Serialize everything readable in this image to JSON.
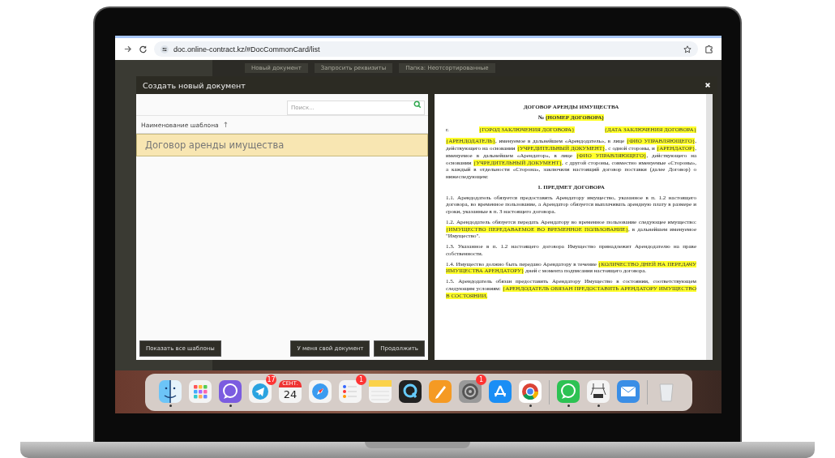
{
  "browser": {
    "url": "doc.online-contract.kz/#DocCommonCard/list"
  },
  "background_toolbar": [
    "Новый документ",
    "Запросить реквизиты",
    "Папка: Неотсортированные"
  ],
  "dialog": {
    "title": "Создать новый документ",
    "search": {
      "placeholder": "Поиск..."
    },
    "column_header": {
      "label": "Наименование шаблона",
      "sort_icon": "↑"
    },
    "templates": [
      {
        "name": "Договор аренды имущества",
        "selected": true
      }
    ],
    "buttons_left": [
      "Показать все шаблоны"
    ],
    "buttons_right": [
      "У меня свой документ",
      "Продолжить"
    ],
    "document": [
      {
        "kind": "title",
        "segments": [
          {
            "text": "ДОГОВОР АРЕНДЫ ИМУЩЕСТВА"
          }
        ]
      },
      {
        "kind": "title",
        "segments": [
          {
            "text": "№ "
          },
          {
            "field": "{НОМЕР ДОГОВОРА}"
          }
        ]
      },
      {
        "kind": "place",
        "segments": [
          {
            "text": "г."
          },
          {
            "field": "{ГОРОД ЗАКЛЮЧЕНИЯ ДОГОВОРА}"
          },
          {
            "field": "{ДАТА ЗАКЛЮЧЕНИЯ ДОГОВОРА}"
          }
        ]
      },
      {
        "kind": "paragraph",
        "segments": [
          {
            "field": "{АРЕНДОДАТЕЛЬ}"
          },
          {
            "text": ", именуемое в дальнейшем «Арендодатель», в лице "
          },
          {
            "field": "{ФИО УПРАВЛЯЮЩЕГО}"
          },
          {
            "text": ", действующего на основании "
          },
          {
            "field": "{УЧРЕДИТЕЛЬНЫЙ ДОКУМЕНТ}"
          },
          {
            "text": ", с одной стороны, и "
          },
          {
            "field": "{АРЕНДАТОР}"
          },
          {
            "text": ", именуемое в дальнейшем «Арендатор», в лице "
          },
          {
            "field": "{ФИО УПРАВЛЯЮЩЕГО}"
          },
          {
            "text": ", действующего на основании "
          },
          {
            "field": "{УЧРЕДИТЕЛЬНЫЙ ДОКУМЕНТ}"
          },
          {
            "text": ", с другой стороны, совместно именуемые «Стороны», а каждый в отдельности «Сторона», заключили настоящий договор поставки (далее Договор) о нижеследующем:"
          }
        ]
      },
      {
        "kind": "heading",
        "segments": [
          {
            "text": "1. ПРЕДМЕТ ДОГОВОРА"
          }
        ]
      },
      {
        "kind": "paragraph",
        "segments": [
          {
            "text": "1.1. Арендодатель обязуется предоставить Арендатору имущество, указанное в п. 1.2 настоящего договора, во временное пользование, а Арендатор обязуется выплачивать арендную плату в размере и сроки, указанные в п. 3 настоящего договора."
          }
        ]
      },
      {
        "kind": "paragraph",
        "segments": [
          {
            "text": "1.2. Арендодатель обязуется передать Арендатору во временное пользование следующее имущество: "
          },
          {
            "field": "{ИМУЩЕСТВО ПЕРЕДАВАЕМОЕ ВО ВРЕМЕННОЕ ПОЛЬЗОВАНИЕ}"
          },
          {
            "text": ", в дальнейшем именуемое \"Имущество\"."
          }
        ]
      },
      {
        "kind": "paragraph",
        "segments": [
          {
            "text": "1.3. Указанное в п. 1.2 настоящего договора Имущество принадлежит Арендодателю на праве собственности."
          }
        ]
      },
      {
        "kind": "paragraph",
        "segments": [
          {
            "text": "1.4. Имущество должно быть передано Арендатору в течение "
          },
          {
            "field": "{КОЛИЧЕСТВО ДНЕЙ НА ПЕРЕДАЧУ ИМУЩЕСТВА АРЕНДАТОРУ}"
          },
          {
            "text": " дней с момента подписания настоящего договора."
          }
        ]
      },
      {
        "kind": "paragraph",
        "segments": [
          {
            "text": "1.5. Арендодатель обязан предоставить Арендатору Имущество в состоянии, соответствующем следующим условиям: "
          },
          {
            "field": "{АРЕНДОДАТЕЛЬ ОБЯЗАН ПРЕДОСТАВИТЬ АРЕНДАТОРУ ИМУЩЕСТВО В СОСТОЯНИИ,"
          }
        ]
      }
    ]
  },
  "dock": [
    {
      "kind": "finder",
      "running": true
    },
    {
      "kind": "launchpad",
      "running": false
    },
    {
      "kind": "viber",
      "running": true
    },
    {
      "kind": "telegram",
      "running": false,
      "badge": "17"
    },
    {
      "kind": "calendar",
      "running": false,
      "month": "СЕНТ.",
      "day": "24"
    },
    {
      "kind": "safari",
      "running": false
    },
    {
      "kind": "reminders",
      "running": false,
      "badge": "1"
    },
    {
      "kind": "notes",
      "running": false
    },
    {
      "kind": "quicktime",
      "running": false
    },
    {
      "kind": "pages",
      "running": false
    },
    {
      "kind": "settings",
      "running": false,
      "badge": "1"
    },
    {
      "kind": "appstore",
      "running": false
    },
    {
      "kind": "chrome",
      "running": true
    },
    {
      "kind": "separator"
    },
    {
      "kind": "whatsapp",
      "running": true
    },
    {
      "kind": "scanner",
      "running": true
    },
    {
      "kind": "mail",
      "running": false
    },
    {
      "kind": "separator"
    },
    {
      "kind": "trash",
      "running": false
    }
  ]
}
